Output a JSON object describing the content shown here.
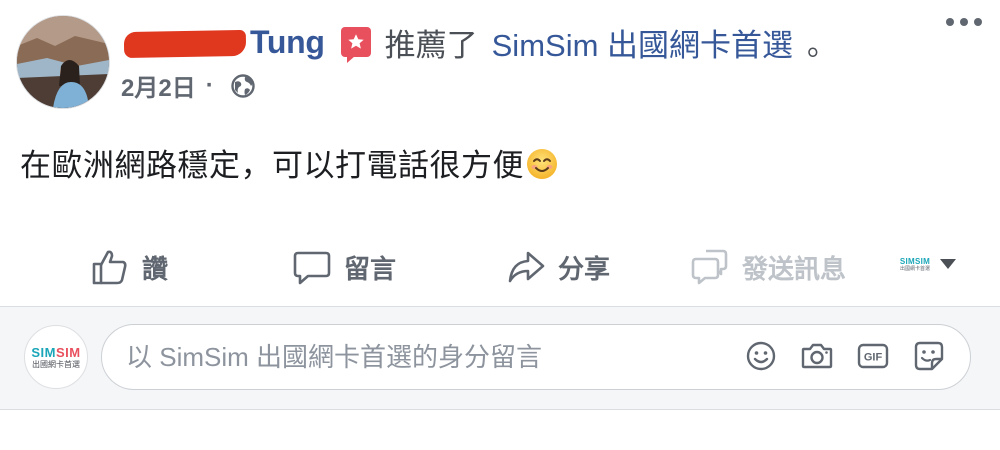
{
  "post": {
    "author_visible": "Tung",
    "action_verb": "推薦了",
    "page_name": "SimSim 出國網卡首選",
    "period": "。",
    "date": "2月2日",
    "meta_separator": "·",
    "body_text": "在歐洲網路穩定，可以打電話很方便"
  },
  "actions": {
    "like": "讚",
    "comment": "留言",
    "share": "分享",
    "send": "發送訊息"
  },
  "page_logo": {
    "mini_line1": "SIMSIM",
    "mini_line2": "出國網卡首選",
    "line1_a": "SIM",
    "line1_b": "SIM",
    "line2": "出國網卡首選"
  },
  "composer": {
    "placeholder": "以 SimSim 出國網卡首選的身分留言"
  },
  "colors": {
    "link": "#365899",
    "badge": "#e9505e",
    "muted": "#606770",
    "brand_teal": "#1aa6b8"
  },
  "icons": [
    "more-options-icon",
    "recommend-star-icon",
    "globe-icon",
    "smile-emoji-icon",
    "like-thumb-icon",
    "comment-bubble-icon",
    "share-arrow-icon",
    "send-message-icon",
    "caret-down-icon",
    "emoji-picker-icon",
    "camera-icon",
    "gif-icon",
    "sticker-icon"
  ]
}
